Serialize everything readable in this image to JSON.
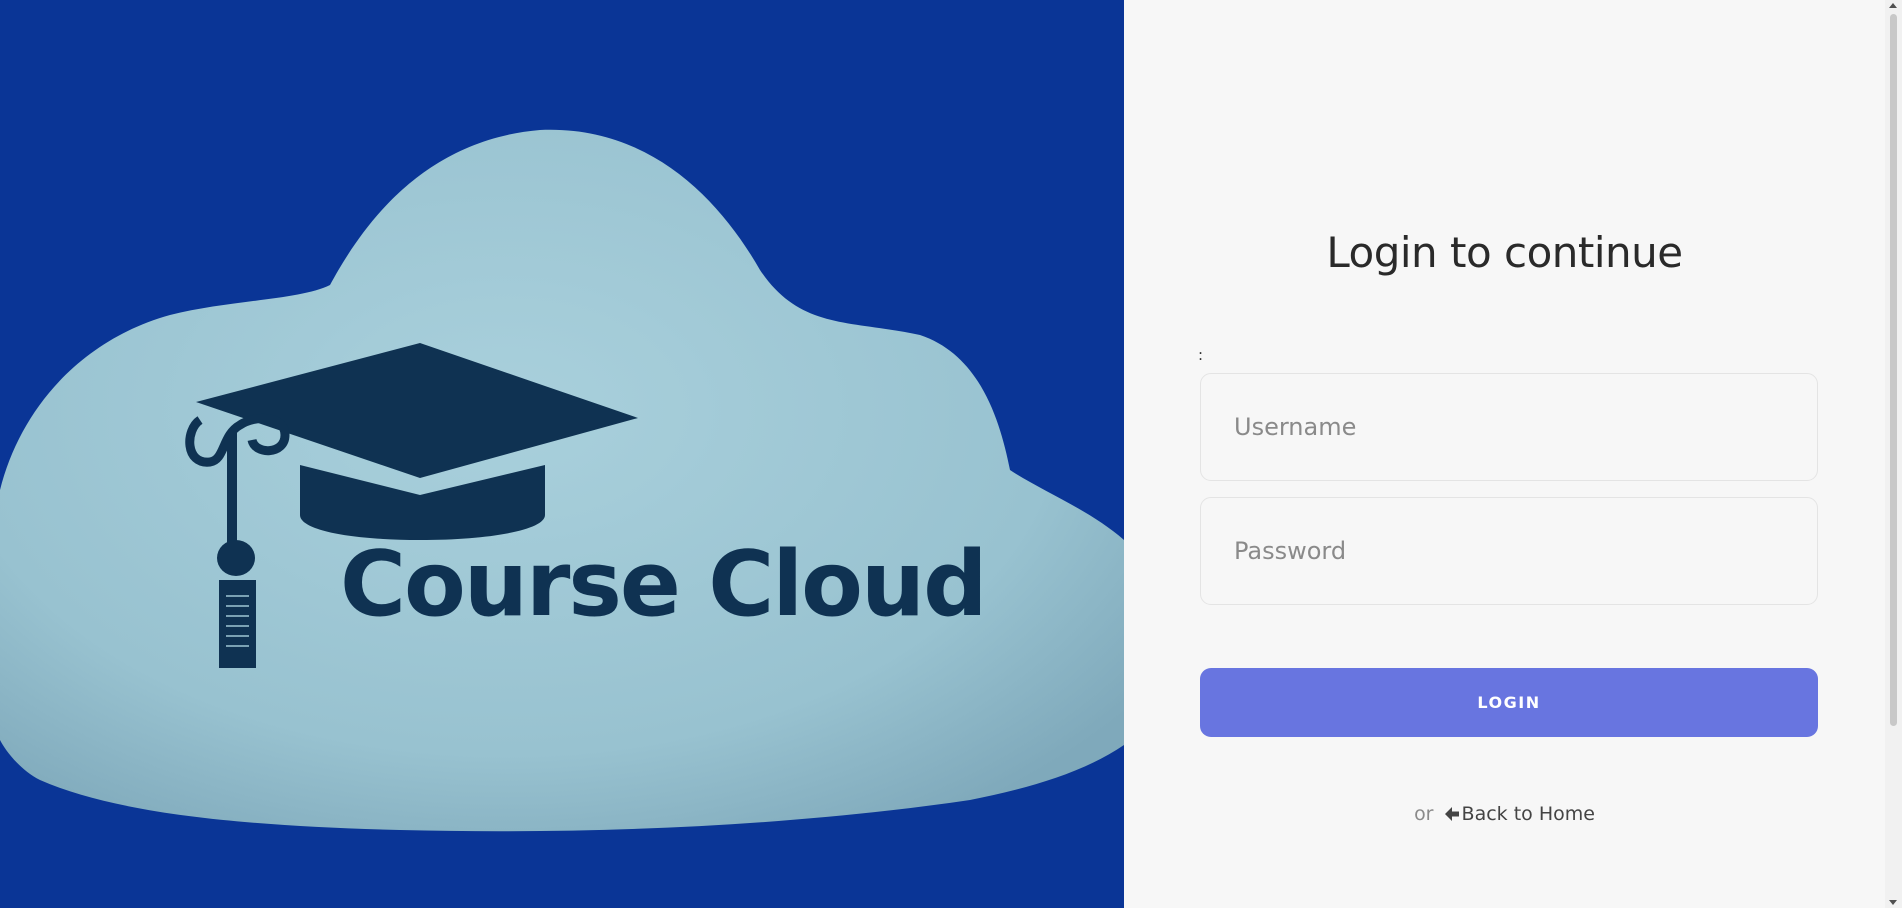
{
  "colors": {
    "hero_background": "#0a3596",
    "cloud": "#9dc6d3",
    "logo_dark": "#0f3252",
    "panel_background": "#f7f7f7",
    "button": "#6875e0"
  },
  "hero": {
    "brand_name": "Course Cloud",
    "logo_icon": "graduation-cap-icon"
  },
  "login": {
    "title": "Login to continue",
    "stray_label": ":",
    "username_placeholder": "Username",
    "password_placeholder": "Password",
    "button_label": "LOGIN",
    "back_prefix": "or",
    "back_icon": "arrow-left-icon",
    "back_label": "Back to Home"
  }
}
